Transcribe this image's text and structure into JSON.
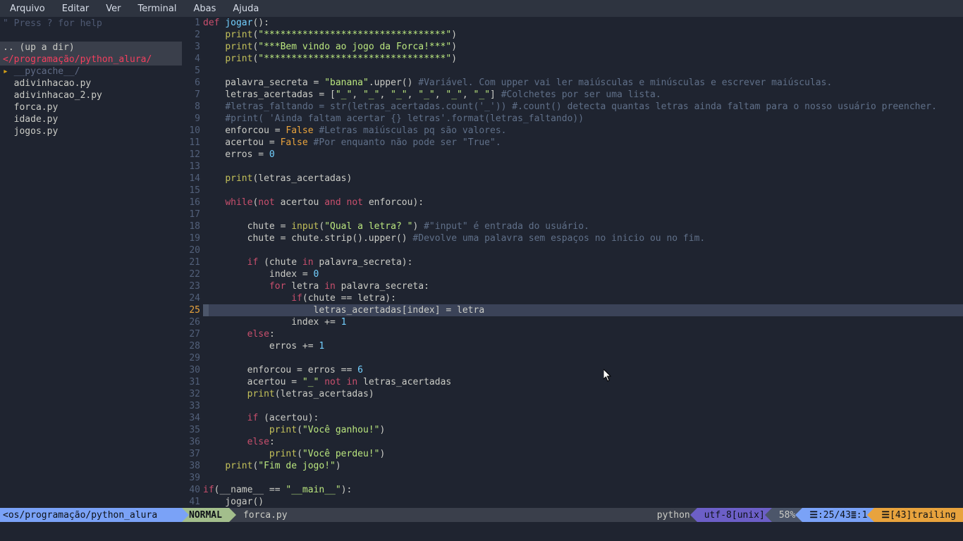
{
  "menubar": [
    "Arquivo",
    "Editar",
    "Ver",
    "Terminal",
    "Abas",
    "Ajuda"
  ],
  "sidebar": {
    "help": "\" Press ? for help",
    "updir": ".. (up a dir)",
    "path": "</programação/python_alura/",
    "items": [
      {
        "type": "dir",
        "expand": "▸",
        "name": "__pycache__/"
      },
      {
        "type": "file",
        "name": "adivinhacao.py"
      },
      {
        "type": "file",
        "name": "adivinhacao_2.py"
      },
      {
        "type": "file",
        "name": "forca.py"
      },
      {
        "type": "file",
        "name": "idade.py"
      },
      {
        "type": "file",
        "name": "jogos.py"
      }
    ]
  },
  "code": {
    "current_line": 25,
    "lines": [
      {
        "n": 1,
        "segs": [
          [
            "kw-def",
            "def "
          ],
          [
            "kw-fn",
            "jogar"
          ],
          [
            "punct",
            "():"
          ]
        ]
      },
      {
        "n": 2,
        "segs": [
          [
            "plain",
            "    "
          ],
          [
            "kw-call",
            "print"
          ],
          [
            "punct",
            "("
          ],
          [
            "str",
            "\"*********************************\""
          ],
          [
            "punct",
            ")"
          ]
        ]
      },
      {
        "n": 3,
        "segs": [
          [
            "plain",
            "    "
          ],
          [
            "kw-call",
            "print"
          ],
          [
            "punct",
            "("
          ],
          [
            "str",
            "\"***Bem vindo ao jogo da Forca!***\""
          ],
          [
            "punct",
            ")"
          ]
        ]
      },
      {
        "n": 4,
        "segs": [
          [
            "plain",
            "    "
          ],
          [
            "kw-call",
            "print"
          ],
          [
            "punct",
            "("
          ],
          [
            "str",
            "\"*********************************\""
          ],
          [
            "punct",
            ")"
          ]
        ]
      },
      {
        "n": 5,
        "segs": []
      },
      {
        "n": 6,
        "segs": [
          [
            "plain",
            "    palavra_secreta = "
          ],
          [
            "str",
            "\"banana\""
          ],
          [
            "plain",
            ".upper() "
          ],
          [
            "cmt",
            "#Variável. Com upper vai ler maiúsculas e minúsculas e escrever maiúsculas."
          ]
        ]
      },
      {
        "n": 7,
        "segs": [
          [
            "plain",
            "    letras_acertadas = ["
          ],
          [
            "str",
            "\"_\""
          ],
          [
            "plain",
            ", "
          ],
          [
            "str",
            "\"_\""
          ],
          [
            "plain",
            ", "
          ],
          [
            "str",
            "\"_\""
          ],
          [
            "plain",
            ", "
          ],
          [
            "str",
            "\"_\""
          ],
          [
            "plain",
            ", "
          ],
          [
            "str",
            "\"_\""
          ],
          [
            "plain",
            ", "
          ],
          [
            "str",
            "\"_\""
          ],
          [
            "plain",
            "] "
          ],
          [
            "cmt",
            "#Colchetes por ser uma lista."
          ]
        ]
      },
      {
        "n": 8,
        "segs": [
          [
            "plain",
            "    "
          ],
          [
            "cmt",
            "#letras_faltando = str(letras_acertadas.count('_')) #.count() detecta quantas letras ainda faltam para o nosso usuário preencher."
          ]
        ]
      },
      {
        "n": 9,
        "segs": [
          [
            "plain",
            "    "
          ],
          [
            "cmt",
            "#print( 'Ainda faltam acertar {} letras'.format(letras_faltando))"
          ]
        ]
      },
      {
        "n": 10,
        "segs": [
          [
            "plain",
            "    enforcou = "
          ],
          [
            "kw-orange",
            "False"
          ],
          [
            "plain",
            " "
          ],
          [
            "cmt",
            "#Letras maiúsculas pq são valores."
          ]
        ]
      },
      {
        "n": 11,
        "segs": [
          [
            "plain",
            "    acertou = "
          ],
          [
            "kw-orange",
            "False"
          ],
          [
            "plain",
            " "
          ],
          [
            "cmt",
            "#Por enquanto não pode ser \"True\"."
          ]
        ]
      },
      {
        "n": 12,
        "segs": [
          [
            "plain",
            "    erros = "
          ],
          [
            "num",
            "0"
          ]
        ]
      },
      {
        "n": 13,
        "segs": []
      },
      {
        "n": 14,
        "segs": [
          [
            "plain",
            "    "
          ],
          [
            "kw-call",
            "print"
          ],
          [
            "punct",
            "(letras_acertadas)"
          ]
        ]
      },
      {
        "n": 15,
        "segs": []
      },
      {
        "n": 16,
        "segs": [
          [
            "plain",
            "    "
          ],
          [
            "kw-red",
            "while"
          ],
          [
            "punct",
            "("
          ],
          [
            "kw-red",
            "not"
          ],
          [
            "plain",
            " acertou "
          ],
          [
            "kw-red",
            "and"
          ],
          [
            "plain",
            " "
          ],
          [
            "kw-red",
            "not"
          ],
          [
            "plain",
            " enforcou):"
          ]
        ]
      },
      {
        "n": 17,
        "segs": []
      },
      {
        "n": 18,
        "segs": [
          [
            "plain",
            "        chute = "
          ],
          [
            "kw-call",
            "input"
          ],
          [
            "punct",
            "("
          ],
          [
            "str",
            "\"Qual a letra? \""
          ],
          [
            "punct",
            ") "
          ],
          [
            "cmt",
            "#\"input\" é entrada do usuário."
          ]
        ]
      },
      {
        "n": 19,
        "segs": [
          [
            "plain",
            "        chute = chute.strip().upper() "
          ],
          [
            "cmt",
            "#Devolve uma palavra sem espaços no inicio ou no fim."
          ]
        ]
      },
      {
        "n": 20,
        "segs": []
      },
      {
        "n": 21,
        "segs": [
          [
            "plain",
            "        "
          ],
          [
            "kw-red",
            "if"
          ],
          [
            "plain",
            " (chute "
          ],
          [
            "kw-red",
            "in"
          ],
          [
            "plain",
            " palavra_secreta):"
          ]
        ]
      },
      {
        "n": 22,
        "segs": [
          [
            "plain",
            "            index = "
          ],
          [
            "num",
            "0"
          ]
        ]
      },
      {
        "n": 23,
        "segs": [
          [
            "plain",
            "            "
          ],
          [
            "kw-red",
            "for"
          ],
          [
            "plain",
            " letra "
          ],
          [
            "kw-red",
            "in"
          ],
          [
            "plain",
            " palavra_secreta:"
          ]
        ]
      },
      {
        "n": 24,
        "segs": [
          [
            "plain",
            "                "
          ],
          [
            "kw-red",
            "if"
          ],
          [
            "punct",
            "(chute == letra):"
          ]
        ]
      },
      {
        "n": 25,
        "hl": true,
        "segs": [
          [
            "plain",
            "                    letras_acertadas[index] = letra"
          ]
        ]
      },
      {
        "n": 26,
        "segs": [
          [
            "plain",
            "                index += "
          ],
          [
            "num",
            "1"
          ]
        ]
      },
      {
        "n": 27,
        "segs": [
          [
            "plain",
            "        "
          ],
          [
            "kw-red",
            "else"
          ],
          [
            "punct",
            ":"
          ]
        ]
      },
      {
        "n": 28,
        "segs": [
          [
            "plain",
            "            erros += "
          ],
          [
            "num",
            "1"
          ]
        ]
      },
      {
        "n": 29,
        "segs": []
      },
      {
        "n": 30,
        "segs": [
          [
            "plain",
            "        enforcou = erros == "
          ],
          [
            "num",
            "6"
          ]
        ]
      },
      {
        "n": 31,
        "segs": [
          [
            "plain",
            "        acertou = "
          ],
          [
            "str",
            "\"_\""
          ],
          [
            "plain",
            " "
          ],
          [
            "kw-red",
            "not in"
          ],
          [
            "plain",
            " letras_acertadas"
          ]
        ]
      },
      {
        "n": 32,
        "segs": [
          [
            "plain",
            "        "
          ],
          [
            "kw-call",
            "print"
          ],
          [
            "punct",
            "(letras_acertadas)"
          ]
        ]
      },
      {
        "n": 33,
        "segs": []
      },
      {
        "n": 34,
        "segs": [
          [
            "plain",
            "        "
          ],
          [
            "kw-red",
            "if"
          ],
          [
            "plain",
            " (acertou):"
          ]
        ]
      },
      {
        "n": 35,
        "segs": [
          [
            "plain",
            "            "
          ],
          [
            "kw-call",
            "print"
          ],
          [
            "punct",
            "("
          ],
          [
            "str",
            "\"Você ganhou!\""
          ],
          [
            "punct",
            ")"
          ]
        ]
      },
      {
        "n": 36,
        "segs": [
          [
            "plain",
            "        "
          ],
          [
            "kw-red",
            "else"
          ],
          [
            "punct",
            ":"
          ]
        ]
      },
      {
        "n": 37,
        "segs": [
          [
            "plain",
            "            "
          ],
          [
            "kw-call",
            "print"
          ],
          [
            "punct",
            "("
          ],
          [
            "str",
            "\"Você perdeu!\""
          ],
          [
            "punct",
            ")"
          ]
        ]
      },
      {
        "n": 38,
        "segs": [
          [
            "plain",
            "    "
          ],
          [
            "kw-call",
            "print"
          ],
          [
            "punct",
            "("
          ],
          [
            "str",
            "\"Fim de jogo!\""
          ],
          [
            "punct",
            ")"
          ]
        ]
      },
      {
        "n": 39,
        "segs": []
      },
      {
        "n": 40,
        "segs": [
          [
            "kw-red",
            "if"
          ],
          [
            "punct",
            "(__name__ == "
          ],
          [
            "str",
            "\"__main__\""
          ],
          [
            "punct",
            "):"
          ]
        ]
      },
      {
        "n": 41,
        "segs": [
          [
            "plain",
            "    jogar()"
          ]
        ]
      }
    ]
  },
  "status": {
    "path": "<os/programação/python_alura",
    "mode": "NORMAL",
    "file": "forca.py",
    "filetype": "python",
    "encoding": "utf-8[unix]",
    "percent": "58%",
    "line_sym": "☰",
    "pos_line": ":25/43",
    "col_sym": "≣",
    "pos_col": ":1",
    "trail_sym": "☰",
    "trailing": "[43]trailing"
  }
}
